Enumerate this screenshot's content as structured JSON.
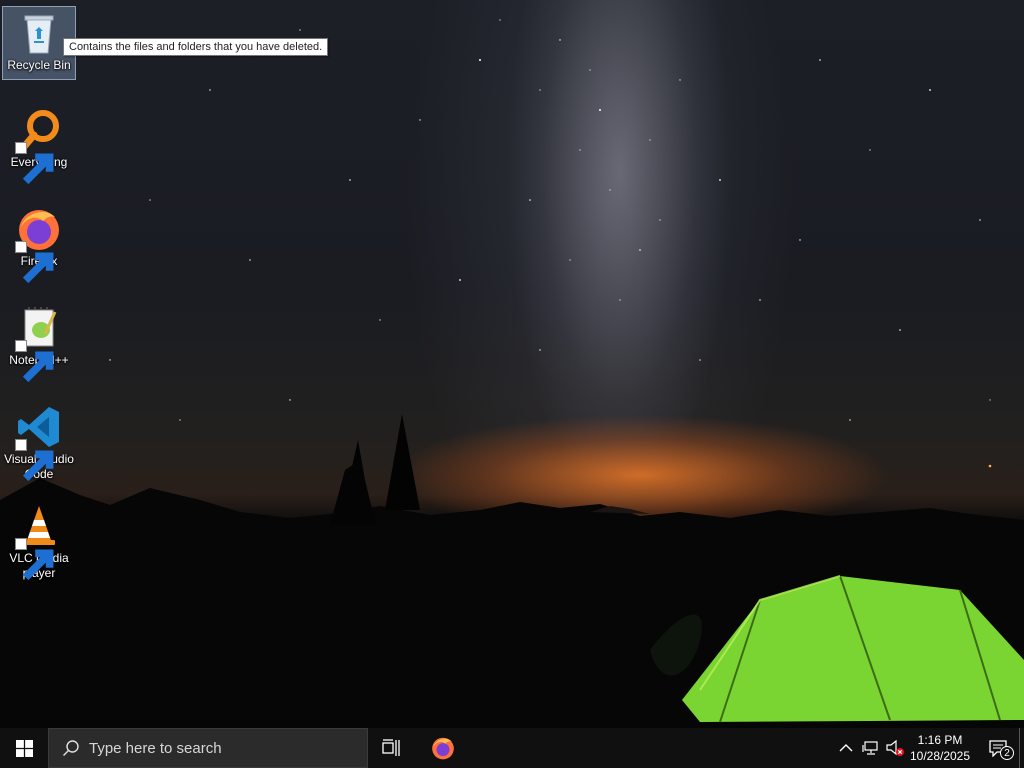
{
  "desktop": {
    "icons": [
      {
        "label": "Recycle Bin",
        "icon": "recycle-bin-icon",
        "selected": true
      },
      {
        "label": "Everything",
        "icon": "everything-search-icon"
      },
      {
        "label": "Firefox",
        "icon": "firefox-icon"
      },
      {
        "label": "Notepad++",
        "icon": "notepadpp-icon"
      },
      {
        "label": "Visual Studio Code",
        "icon": "vscode-icon"
      },
      {
        "label": "VLC media player",
        "icon": "vlc-icon"
      }
    ],
    "tooltip": "Contains the files and folders that you have deleted."
  },
  "taskbar": {
    "start_icon": "windows-logo-icon",
    "search_placeholder": "Type here to search",
    "pinned": [
      "task-view-icon",
      "firefox-icon"
    ],
    "tray": {
      "icons": [
        "chevron-up-icon",
        "network-icon",
        "volume-muted-icon"
      ],
      "time": "1:16 PM",
      "date": "10/28/2025",
      "notification_count": "2"
    }
  },
  "colors": {
    "taskbar_bg": "#101010",
    "search_bg": "#2b2b2b",
    "glow": "#e2792a",
    "tent": "#8ee03a"
  }
}
